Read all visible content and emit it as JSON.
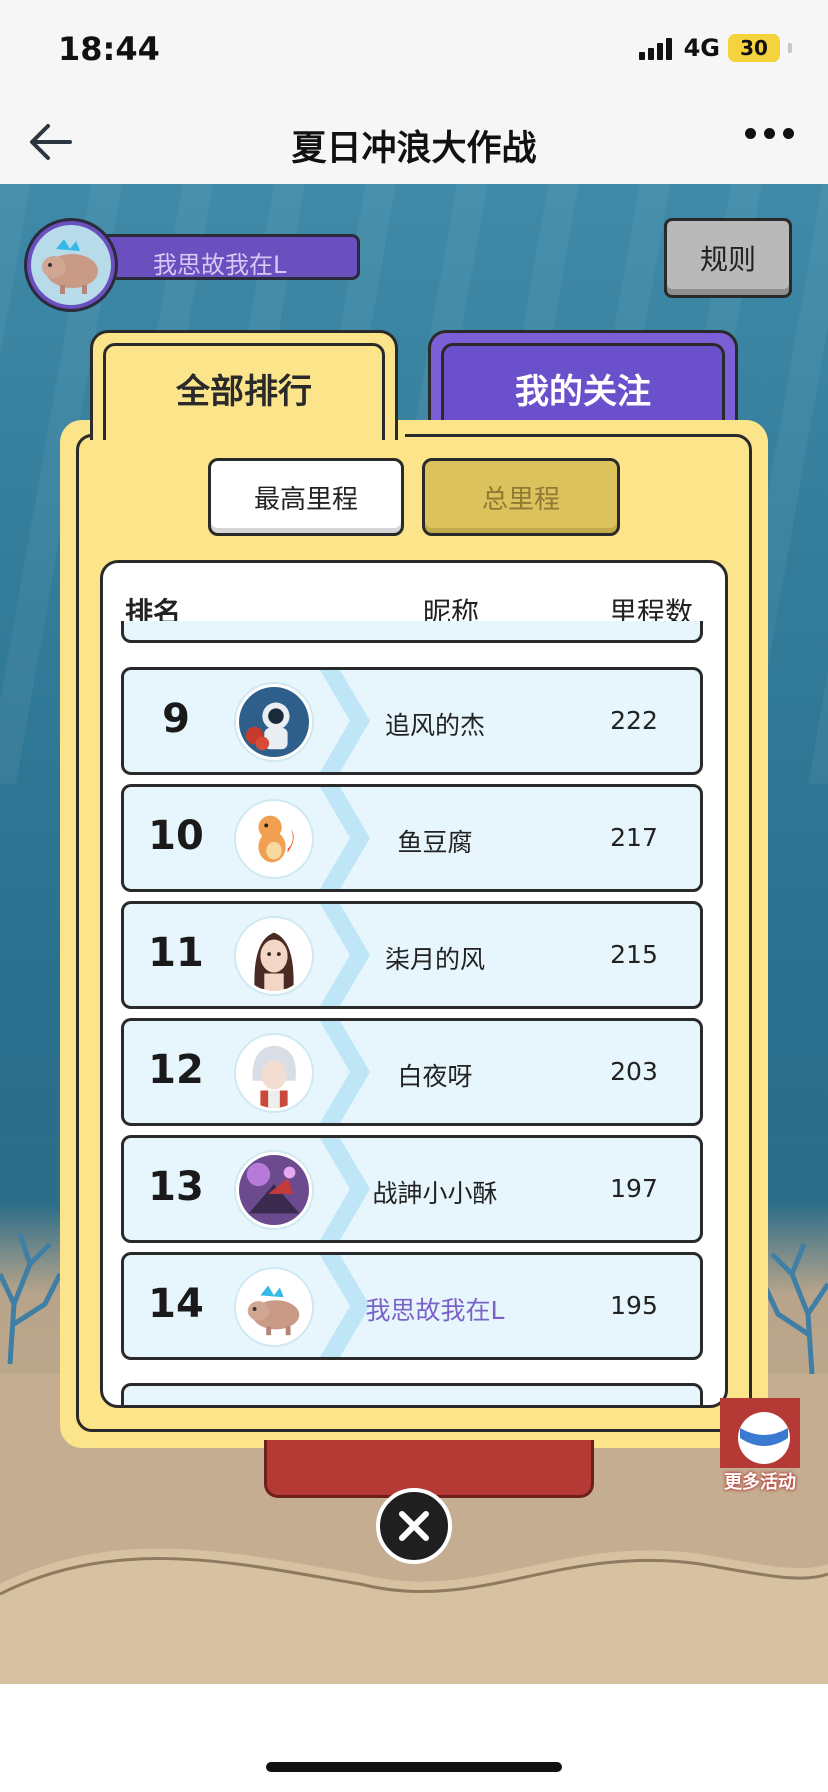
{
  "status_bar": {
    "time": "18:44",
    "network": "4G",
    "battery": "30"
  },
  "nav": {
    "title": "夏日冲浪大作战",
    "back_icon": "arrow-left-icon",
    "more_icon": "more-horizontal-icon"
  },
  "user": {
    "name": "我思故我在L"
  },
  "rules_button": "规则",
  "tabs": [
    {
      "label": "全部排行",
      "active": true
    },
    {
      "label": "我的关注",
      "active": false
    }
  ],
  "subtabs": [
    {
      "label": "最高里程",
      "active": true
    },
    {
      "label": "总里程",
      "active": false
    }
  ],
  "table": {
    "headers": {
      "rank": "排名",
      "nickname": "昵称",
      "distance": "里程数"
    },
    "rows": [
      {
        "rank": "9",
        "nickname": "追风的杰",
        "distance": "222",
        "avatar": "astronaut-avatar",
        "is_self": false
      },
      {
        "rank": "10",
        "nickname": "鱼豆腐",
        "distance": "217",
        "avatar": "orange-dragon-avatar",
        "is_self": false
      },
      {
        "rank": "11",
        "nickname": "柒月的风",
        "distance": "215",
        "avatar": "girl-avatar",
        "is_self": false
      },
      {
        "rank": "12",
        "nickname": "白夜呀",
        "distance": "203",
        "avatar": "white-hair-avatar",
        "is_self": false
      },
      {
        "rank": "13",
        "nickname": "战訷小小酥",
        "distance": "197",
        "avatar": "purple-mech-avatar",
        "is_self": false
      },
      {
        "rank": "14",
        "nickname": "我思故我在L",
        "distance": "195",
        "avatar": "capybara-avatar",
        "is_self": true
      }
    ]
  },
  "more_activity": "更多活动",
  "colors": {
    "panel": "#fbe48a",
    "tab_follow": "#6b50cc",
    "row_bg": "#e6f6fc",
    "self_name": "#7a62c9",
    "red_button": "#b53a35"
  }
}
